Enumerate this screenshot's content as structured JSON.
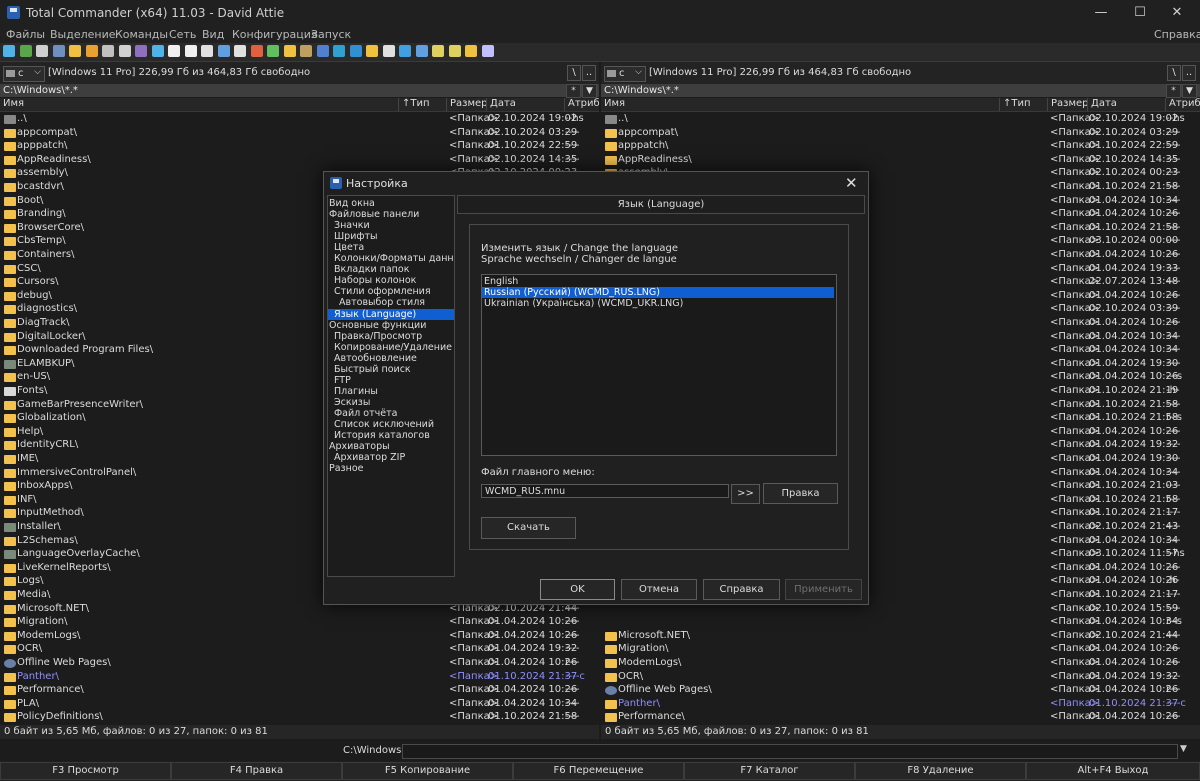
{
  "window": {
    "title": "Total Commander (x64) 11.03 - David Attie",
    "controls": [
      "—",
      "☐",
      "✕"
    ]
  },
  "menu": {
    "items": [
      "Файлы",
      "Выделение",
      "Команды",
      "Сеть",
      "Вид",
      "Конфигурация",
      "Запуск"
    ],
    "help": "Справка"
  },
  "toolbar": {
    "icons": [
      "refresh-icon",
      "thumbnails-icon",
      "view-icon",
      "tree-icon",
      "settings-icon",
      "pack-icon",
      "unpack-icon",
      "search-icon",
      "rename-icon",
      "sync-icon",
      "ftp-icon",
      "ftp-new-icon",
      "cmd-icon",
      "notepad-icon",
      "copy-names-icon",
      "compare-icon",
      "filter-icon",
      "bookmark-icon",
      "archive-icon",
      "globe-icon",
      "mail-icon",
      "edit-icon",
      "folder-icon",
      "network-icon",
      "browser-icon",
      "monitor-icon",
      "calendar-icon",
      "note-icon",
      "plugin-icon",
      "help-icon"
    ],
    "colors": [
      "#4fb3e8",
      "#5aa64a",
      "#cfcfcf",
      "#6f8fbf",
      "#f0c040",
      "#e9a030",
      "#c0c0c0",
      "#d0d0d0",
      "#8f6fbf",
      "#4fb3e8",
      "#f0f0f0",
      "#f0f0f0",
      "#e0e0e0",
      "#60a0e0",
      "#e0e0e0",
      "#e06040",
      "#60c060",
      "#f0c040",
      "#c0a060",
      "#5080d0",
      "#30a0d0",
      "#3090d0",
      "#f0c040",
      "#e0e0e0",
      "#40a0e0",
      "#60a0e0",
      "#e0d060",
      "#e0d060",
      "#f0c040",
      "#c0c0ff"
    ]
  },
  "left_panel": {
    "drive_letter": "c",
    "drive_label": "[Windows 11 Pro]  226,99 Гб из 464,83 Гб свободно",
    "root_btn": "\\",
    "up_btn": "..",
    "path": "C:\\Windows\\*.*",
    "star_btn": "*",
    "dropdown_btn": "▼",
    "columns": {
      "name": "Имя",
      "type": "↑Тип",
      "size": "Размер",
      "date": "Дата",
      "attr": "Атрибу"
    },
    "rows": [
      {
        "name": "..\\",
        "size": "<Папка>",
        "date": "02.10.2024 19:02",
        "attr": "--hs",
        "icon": "up"
      },
      {
        "name": "appcompat\\",
        "size": "<Папка>",
        "date": "02.10.2024 03:29",
        "attr": "----",
        "icon": "folder"
      },
      {
        "name": "apppatch\\",
        "size": "<Папка>",
        "date": "01.10.2024 22:59",
        "attr": "----",
        "icon": "folder"
      },
      {
        "name": "AppReadiness\\",
        "size": "<Папка>",
        "date": "02.10.2024 14:35",
        "attr": "----",
        "icon": "folder"
      },
      {
        "name": "assembly\\",
        "size": "<Папка>",
        "date": "02.10.2024 00:23",
        "attr": "----",
        "icon": "folder"
      },
      {
        "name": "bcastdvr\\",
        "size": "",
        "date": "",
        "attr": "",
        "icon": "folder"
      },
      {
        "name": "Boot\\",
        "size": "",
        "date": "",
        "attr": "",
        "icon": "folder"
      },
      {
        "name": "Branding\\",
        "size": "",
        "date": "",
        "attr": "",
        "icon": "folder"
      },
      {
        "name": "BrowserCore\\",
        "size": "",
        "date": "",
        "attr": "",
        "icon": "folder"
      },
      {
        "name": "CbsTemp\\",
        "size": "",
        "date": "",
        "attr": "",
        "icon": "folder"
      },
      {
        "name": "Containers\\",
        "size": "",
        "date": "",
        "attr": "",
        "icon": "folder"
      },
      {
        "name": "CSC\\",
        "size": "",
        "date": "",
        "attr": "",
        "icon": "folder"
      },
      {
        "name": "Cursors\\",
        "size": "",
        "date": "",
        "attr": "",
        "icon": "folder"
      },
      {
        "name": "debug\\",
        "size": "",
        "date": "",
        "attr": "",
        "icon": "folder"
      },
      {
        "name": "diagnostics\\",
        "size": "",
        "date": "",
        "attr": "",
        "icon": "folder"
      },
      {
        "name": "DiagTrack\\",
        "size": "",
        "date": "",
        "attr": "",
        "icon": "folder"
      },
      {
        "name": "DigitalLocker\\",
        "size": "",
        "date": "",
        "attr": "",
        "icon": "folder"
      },
      {
        "name": "Downloaded Program Files\\",
        "size": "",
        "date": "",
        "attr": "",
        "icon": "folder"
      },
      {
        "name": "ELAMBKUP\\",
        "size": "",
        "date": "",
        "attr": "",
        "icon": "gray"
      },
      {
        "name": "en-US\\",
        "size": "",
        "date": "",
        "attr": "",
        "icon": "folder"
      },
      {
        "name": "Fonts\\",
        "size": "",
        "date": "",
        "attr": "",
        "icon": "font"
      },
      {
        "name": "GameBarPresenceWriter\\",
        "size": "",
        "date": "",
        "attr": "",
        "icon": "folder"
      },
      {
        "name": "Globalization\\",
        "size": "",
        "date": "",
        "attr": "",
        "icon": "folder"
      },
      {
        "name": "Help\\",
        "size": "",
        "date": "",
        "attr": "",
        "icon": "folder"
      },
      {
        "name": "IdentityCRL\\",
        "size": "",
        "date": "",
        "attr": "",
        "icon": "folder"
      },
      {
        "name": "IME\\",
        "size": "",
        "date": "",
        "attr": "",
        "icon": "folder"
      },
      {
        "name": "ImmersiveControlPanel\\",
        "size": "",
        "date": "",
        "attr": "",
        "icon": "folder"
      },
      {
        "name": "InboxApps\\",
        "size": "",
        "date": "",
        "attr": "",
        "icon": "folder"
      },
      {
        "name": "INF\\",
        "size": "",
        "date": "",
        "attr": "",
        "icon": "folder"
      },
      {
        "name": "InputMethod\\",
        "size": "",
        "date": "",
        "attr": "",
        "icon": "folder"
      },
      {
        "name": "Installer\\",
        "size": "",
        "date": "",
        "attr": "",
        "icon": "gray"
      },
      {
        "name": "L2Schemas\\",
        "size": "",
        "date": "",
        "attr": "",
        "icon": "folder"
      },
      {
        "name": "LanguageOverlayCache\\",
        "size": "",
        "date": "",
        "attr": "",
        "icon": "gray"
      },
      {
        "name": "LiveKernelReports\\",
        "size": "",
        "date": "",
        "attr": "",
        "icon": "folder"
      },
      {
        "name": "Logs\\",
        "size": "",
        "date": "",
        "attr": "",
        "icon": "folder"
      },
      {
        "name": "Media\\",
        "size": "",
        "date": "",
        "attr": "",
        "icon": "folder"
      },
      {
        "name": "Microsoft.NET\\",
        "size": "<Папка>",
        "date": "02.10.2024 21:44",
        "attr": "----",
        "icon": "folder"
      },
      {
        "name": "Migration\\",
        "size": "<Папка>",
        "date": "01.04.2024 10:26",
        "attr": "----",
        "icon": "folder"
      },
      {
        "name": "ModemLogs\\",
        "size": "<Папка>",
        "date": "01.04.2024 10:26",
        "attr": "----",
        "icon": "folder"
      },
      {
        "name": "OCR\\",
        "size": "<Папка>",
        "date": "01.04.2024 19:32",
        "attr": "----",
        "icon": "folder"
      },
      {
        "name": "Offline Web Pages\\",
        "size": "<Папка>",
        "date": "01.04.2024 10:26",
        "attr": "r---",
        "icon": "web"
      },
      {
        "name": "Panther\\",
        "size": "<Папка>",
        "date": "01.10.2024 21:37",
        "attr": "----c",
        "icon": "folder",
        "style": "blue"
      },
      {
        "name": "Performance\\",
        "size": "<Папка>",
        "date": "01.04.2024 10:26",
        "attr": "----",
        "icon": "folder"
      },
      {
        "name": "PLA\\",
        "size": "<Папка>",
        "date": "01.04.2024 10:34",
        "attr": "----",
        "icon": "folder"
      },
      {
        "name": "PolicyDefinitions\\",
        "size": "<Папка>",
        "date": "01.10.2024 21:58",
        "attr": "----",
        "icon": "folder"
      }
    ],
    "status": "0 байт из 5,65 Мб, файлов: 0 из 27, папок: 0 из 81"
  },
  "right_panel": {
    "drive_letter": "c",
    "drive_label": "[Windows 11 Pro]  226,99 Гб из 464,83 Гб свободно",
    "root_btn": "\\",
    "up_btn": "..",
    "path": "C:\\Windows\\*.*",
    "star_btn": "*",
    "dropdown_btn": "▼",
    "columns": {
      "name": "Имя",
      "type": "↑Тип",
      "size": "Размер",
      "date": "Дата",
      "attr": "Атрибу"
    },
    "rows": [
      {
        "name": "..\\",
        "size": "<Папка>",
        "date": "02.10.2024 19:02",
        "attr": "--hs",
        "icon": "up"
      },
      {
        "name": "appcompat\\",
        "size": "<Папка>",
        "date": "02.10.2024 03:29",
        "attr": "----",
        "icon": "folder"
      },
      {
        "name": "apppatch\\",
        "size": "<Папка>",
        "date": "01.10.2024 22:59",
        "attr": "----",
        "icon": "folder"
      },
      {
        "name": "AppReadiness\\",
        "size": "<Папка>",
        "date": "02.10.2024 14:35",
        "attr": "----",
        "icon": "folder"
      },
      {
        "name": "assembly\\",
        "size": "<Папка>",
        "date": "02.10.2024 00:23",
        "attr": "----",
        "icon": "folder"
      },
      {
        "name": "",
        "size": "<Папка>",
        "date": "01.10.2024 21:58",
        "attr": "----",
        "icon": "none"
      },
      {
        "name": "",
        "size": "<Папка>",
        "date": "01.04.2024 10:34",
        "attr": "----",
        "icon": "none"
      },
      {
        "name": "",
        "size": "<Папка>",
        "date": "01.04.2024 10:26",
        "attr": "----",
        "icon": "none"
      },
      {
        "name": "",
        "size": "<Папка>",
        "date": "01.10.2024 21:58",
        "attr": "----",
        "icon": "none"
      },
      {
        "name": "",
        "size": "<Папка>",
        "date": "03.10.2024 00:00",
        "attr": "----",
        "icon": "none"
      },
      {
        "name": "",
        "size": "<Папка>",
        "date": "01.04.2024 10:26",
        "attr": "----",
        "icon": "none"
      },
      {
        "name": "",
        "size": "<Папка>",
        "date": "01.04.2024 19:33",
        "attr": "----",
        "icon": "none"
      },
      {
        "name": "",
        "size": "<Папка>",
        "date": "22.07.2024 13:48",
        "attr": "----",
        "icon": "none"
      },
      {
        "name": "",
        "size": "<Папка>",
        "date": "01.04.2024 10:26",
        "attr": "----",
        "icon": "none"
      },
      {
        "name": "",
        "size": "<Папка>",
        "date": "02.10.2024 03:39",
        "attr": "----",
        "icon": "none"
      },
      {
        "name": "",
        "size": "<Папка>",
        "date": "01.04.2024 10:26",
        "attr": "----",
        "icon": "none"
      },
      {
        "name": "",
        "size": "<Папка>",
        "date": "01.04.2024 10:34",
        "attr": "----",
        "icon": "none"
      },
      {
        "name": "",
        "size": "<Папка>",
        "date": "01.04.2024 10:34",
        "attr": "----",
        "icon": "none"
      },
      {
        "name": "",
        "size": "<Папка>",
        "date": "01.04.2024 19:30",
        "attr": "----",
        "icon": "none"
      },
      {
        "name": "",
        "size": "<Папка>",
        "date": "01.04.2024 10:26",
        "attr": "---s",
        "icon": "none"
      },
      {
        "name": "",
        "size": "<Папка>",
        "date": "01.10.2024 21:19",
        "attr": "-h-",
        "icon": "none"
      },
      {
        "name": "",
        "size": "<Папка>",
        "date": "01.10.2024 21:58",
        "attr": "----",
        "icon": "none"
      },
      {
        "name": "",
        "size": "<Папка>",
        "date": "01.10.2024 21:58",
        "attr": "r--s",
        "icon": "none"
      },
      {
        "name": "",
        "size": "<Папка>",
        "date": "01.04.2024 10:26",
        "attr": "----",
        "icon": "none"
      },
      {
        "name": "",
        "size": "<Папка>",
        "date": "01.04.2024 19:32",
        "attr": "----",
        "icon": "none"
      },
      {
        "name": "",
        "size": "<Папка>",
        "date": "01.04.2024 19:30",
        "attr": "----",
        "icon": "none"
      },
      {
        "name": "",
        "size": "<Папка>",
        "date": "01.04.2024 10:34",
        "attr": "----",
        "icon": "none"
      },
      {
        "name": "",
        "size": "<Папка>",
        "date": "01.10.2024 21:03",
        "attr": "----",
        "icon": "none"
      },
      {
        "name": "",
        "size": "<Папка>",
        "date": "01.10.2024 21:58",
        "attr": "r---",
        "icon": "none"
      },
      {
        "name": "",
        "size": "<Папка>",
        "date": "01.10.2024 21:17",
        "attr": "----",
        "icon": "none"
      },
      {
        "name": "",
        "size": "<Папка>",
        "date": "02.10.2024 21:43",
        "attr": "----",
        "icon": "none"
      },
      {
        "name": "",
        "size": "<Папка>",
        "date": "01.04.2024 10:34",
        "attr": "----",
        "icon": "none"
      },
      {
        "name": "",
        "size": "<Папка>",
        "date": "03.10.2024 11:57",
        "attr": "--hs",
        "icon": "none"
      },
      {
        "name": "",
        "size": "<Папка>",
        "date": "01.04.2024 10:26",
        "attr": "----",
        "icon": "none"
      },
      {
        "name": "",
        "size": "<Папка>",
        "date": "01.04.2024 10:26",
        "attr": "-h-",
        "icon": "none"
      },
      {
        "name": "",
        "size": "<Папка>",
        "date": "01.10.2024 21:17",
        "attr": "----",
        "icon": "none"
      },
      {
        "name": "",
        "size": "<Папка>",
        "date": "02.10.2024 15:59",
        "attr": "----",
        "icon": "none"
      },
      {
        "name": "",
        "size": "<Папка>",
        "date": "01.04.2024 10:34",
        "attr": "r--s",
        "icon": "none"
      },
      {
        "name": "Microsoft.NET\\",
        "size": "<Папка>",
        "date": "02.10.2024 21:44",
        "attr": "----",
        "icon": "folder"
      },
      {
        "name": "Migration\\",
        "size": "<Папка>",
        "date": "01.04.2024 10:26",
        "attr": "----",
        "icon": "folder"
      },
      {
        "name": "ModemLogs\\",
        "size": "<Папка>",
        "date": "01.04.2024 10:26",
        "attr": "----",
        "icon": "folder"
      },
      {
        "name": "OCR\\",
        "size": "<Папка>",
        "date": "01.04.2024 19:32",
        "attr": "----",
        "icon": "folder"
      },
      {
        "name": "Offline Web Pages\\",
        "size": "<Папка>",
        "date": "01.04.2024 10:26",
        "attr": "r---",
        "icon": "web"
      },
      {
        "name": "Panther\\",
        "size": "<Папка>",
        "date": "01.10.2024 21:37",
        "attr": "----c",
        "icon": "folder",
        "style": "blue"
      },
      {
        "name": "Performance\\",
        "size": "<Папка>",
        "date": "01.04.2024 10:26",
        "attr": "----",
        "icon": "folder"
      },
      {
        "name": "PLA\\",
        "size": "<Папка>",
        "date": "01.04.2024 10:34",
        "attr": "----",
        "icon": "folder"
      },
      {
        "name": "PolicyDefinitions\\",
        "size": "<Папка>",
        "date": "01.10.2024 21:58",
        "attr": "----",
        "icon": "folder"
      }
    ],
    "status": "0 байт из 5,65 Мб, файлов: 0 из 27, папок: 0 из 81"
  },
  "command_line": {
    "path": "C:\\Windows>",
    "value": ""
  },
  "function_keys": [
    "F3 Просмотр",
    "F4 Правка",
    "F5 Копирование",
    "F6 Перемещение",
    "F7 Каталог",
    "F8 Удаление",
    "Alt+F4 Выход"
  ],
  "dialog": {
    "title": "Настройка",
    "close": "✕",
    "tree": [
      {
        "label": "Вид окна",
        "level": 0
      },
      {
        "label": "Файловые панели",
        "level": 0
      },
      {
        "label": "Значки",
        "level": 1
      },
      {
        "label": "Шрифты",
        "level": 1
      },
      {
        "label": "Цвета",
        "level": 1
      },
      {
        "label": "Колонки/Форматы данных",
        "level": 1
      },
      {
        "label": "Вкладки папок",
        "level": 1
      },
      {
        "label": "Наборы колонок",
        "level": 1
      },
      {
        "label": "Стили оформления",
        "level": 1
      },
      {
        "label": "Автовыбор стиля",
        "level": 2
      },
      {
        "label": "Язык (Language)",
        "level": 1,
        "selected": true
      },
      {
        "label": "Основные функции",
        "level": 0
      },
      {
        "label": "Правка/Просмотр",
        "level": 1
      },
      {
        "label": "Копирование/Удаление",
        "level": 1
      },
      {
        "label": "Автообновление",
        "level": 1
      },
      {
        "label": "Быстрый поиск",
        "level": 1
      },
      {
        "label": "FTP",
        "level": 1
      },
      {
        "label": "Плагины",
        "level": 1
      },
      {
        "label": "Эскизы",
        "level": 1
      },
      {
        "label": "Файл отчёта",
        "level": 1
      },
      {
        "label": "Список исключений",
        "level": 1
      },
      {
        "label": "История каталогов",
        "level": 1
      },
      {
        "label": "Архиваторы",
        "level": 0
      },
      {
        "label": "Архиватор ZIP",
        "level": 1
      },
      {
        "label": "Разное",
        "level": 0
      }
    ],
    "section_title": "Язык (Language)",
    "change_lang_line1": "Изменить язык / Change the language",
    "change_lang_line2": "Sprache wechseln / Changer de langue",
    "languages": [
      {
        "label": "English"
      },
      {
        "label": "Russian (Русский) (WCMD_RUS.LNG)",
        "selected": true
      },
      {
        "label": "Ukrainian (Українська) (WCMD_UKR.LNG)"
      }
    ],
    "menu_file_label": "Файл главного меню:",
    "menu_file_value": "WCMD_RUS.mnu",
    "browse_btn": ">>",
    "edit_btn": "Правка",
    "download_btn": "Скачать",
    "ok_btn": "OK",
    "cancel_btn": "Отмена",
    "help_btn": "Справка",
    "apply_btn": "Применить"
  }
}
